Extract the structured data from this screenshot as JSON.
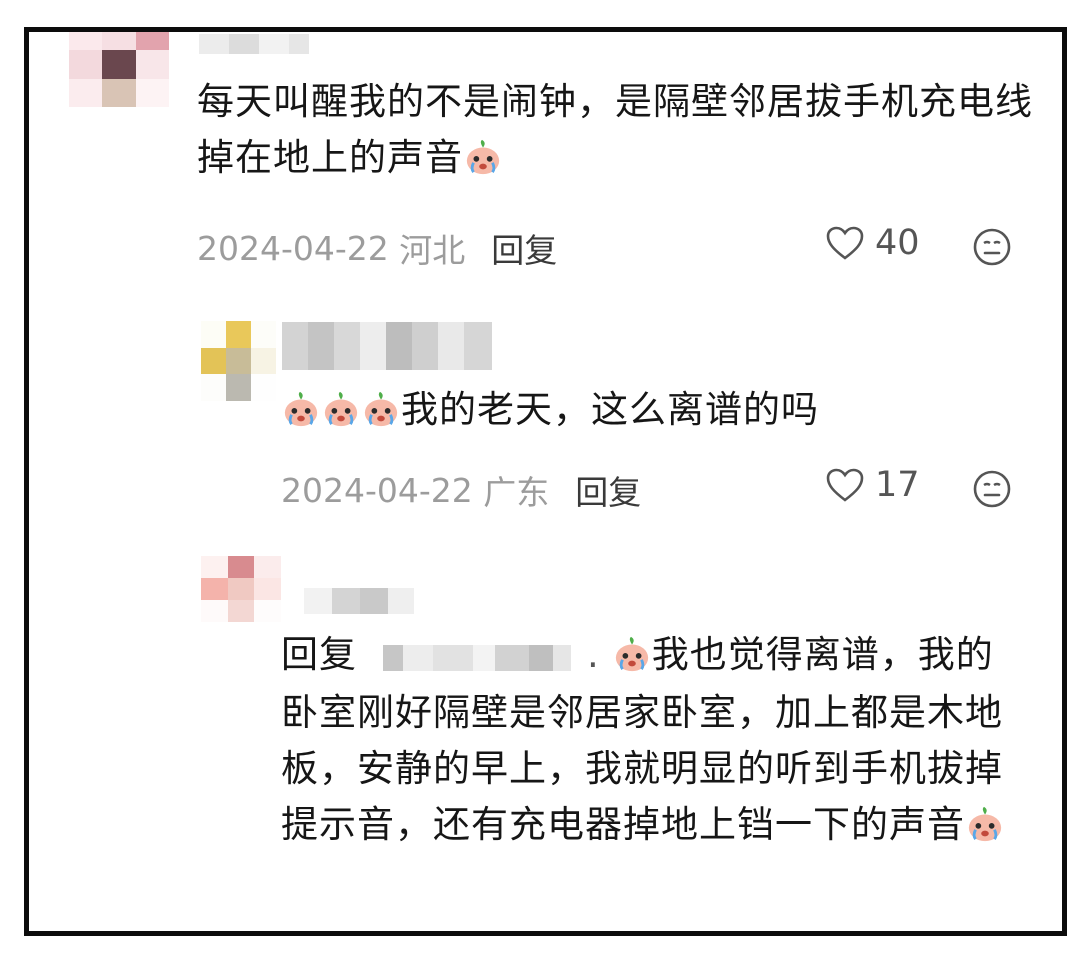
{
  "comments": [
    {
      "text_main": "每天叫醒我的不是闹钟，是隔壁邻居拔手机充电线掉在地上的声音",
      "date": "2024-04-22",
      "region": "河北",
      "reply_label": "回复",
      "like_count": "40"
    },
    {
      "text_main": "我的老天，这么离谱的吗",
      "date": "2024-04-22",
      "region": "广东",
      "reply_label": "回复",
      "like_count": "17"
    },
    {
      "reply_prefix": "回复",
      "text_line1": "我也觉得离谱，我",
      "text_rest": "的卧室刚好隔壁是邻居家卧室，加上都是木地板，安静的早上，我就明显的听到手机拔掉提示音，还有充电器掉地上铛一下的声音"
    }
  ],
  "icons": {
    "like": "heart-outline-icon",
    "dislike": "neutral-face-icon",
    "emoji": "crying-peach-emoji"
  },
  "colors": {
    "text": "#161616",
    "meta": "#9c9c9c",
    "frame": "#0c0c0c"
  }
}
